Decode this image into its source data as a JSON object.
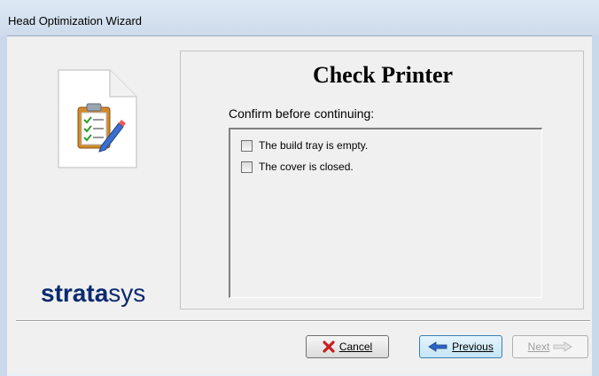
{
  "window": {
    "title": "Head Optimization Wizard"
  },
  "sidebar": {
    "logo_bold": "strata",
    "logo_light": "sys",
    "icon": "clipboard-icon"
  },
  "page": {
    "heading": "Check Printer",
    "instruction": "Confirm before continuing:",
    "checks": [
      {
        "label": "The build tray is empty.",
        "checked": false
      },
      {
        "label": "The cover is closed.",
        "checked": false
      }
    ]
  },
  "buttons": {
    "cancel": {
      "label": "Cancel",
      "icon": "red-x-icon"
    },
    "previous": {
      "label": "Previous",
      "icon": "back-arrow-icon"
    },
    "next": {
      "label": "Next",
      "icon": "forward-arrow-icon",
      "enabled": false
    }
  }
}
